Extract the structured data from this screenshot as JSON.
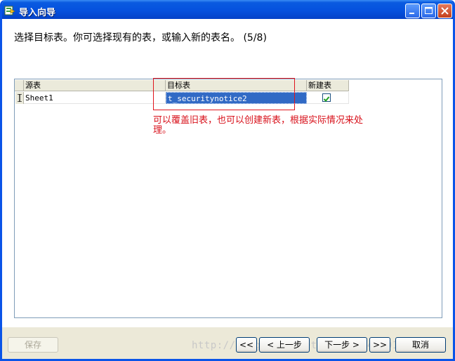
{
  "window": {
    "title": "导入向导"
  },
  "instruction": "选择目标表。你可选择现有的表，或输入新的表名。 (5/8)",
  "table": {
    "columns": [
      "源表",
      "目标表",
      "新建表"
    ],
    "rows": [
      {
        "indicator": "I",
        "source": "Sheet1",
        "target": "t_securitynotice2",
        "new_table": true
      }
    ]
  },
  "annotation": "可以覆盖旧表，也可以创建新表，根据实际情况来处理。",
  "footer": {
    "save_label": "保存",
    "first_label": "<<",
    "prev_label": "< 上一步",
    "next_label": "下一步 >",
    "last_label": ">>",
    "cancel_label": "取消",
    "watermark": "http://blog.csdn.net/weixin_40001345"
  },
  "colors": {
    "title_bar": "#0A54E8",
    "selection": "#316AC5",
    "annotation": "#D8101A"
  },
  "icons": [
    "import-wizard-icon",
    "minimize-icon",
    "maximize-icon",
    "close-icon",
    "row-edit-icon",
    "checkbox-checked-icon"
  ]
}
